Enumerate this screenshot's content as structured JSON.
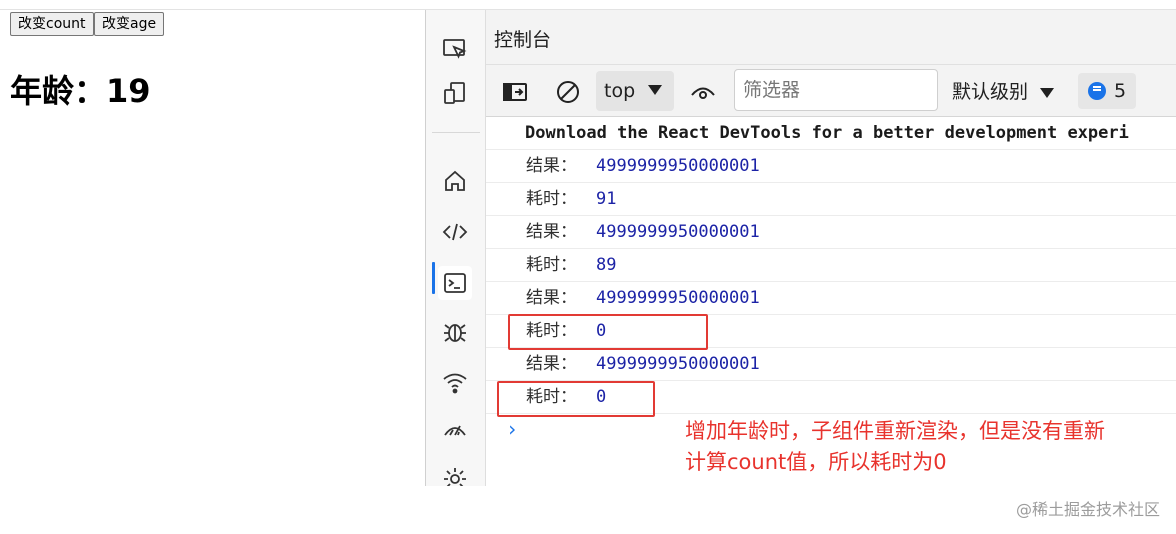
{
  "page": {
    "buttons": {
      "change_count": "改变count",
      "change_age": "改变age"
    },
    "age_label": "年龄：",
    "age_value": "19"
  },
  "devtools": {
    "title": "控制台",
    "toolbar": {
      "context": "top",
      "filter_placeholder": "筛选器",
      "levels": "默认级别",
      "issues_count": "5"
    },
    "activity_icons": [
      "inspect-icon",
      "device-emulation-icon",
      "home-icon",
      "elements-icon",
      "console-icon",
      "sources-bug-icon",
      "network-wifi-icon",
      "performance-icon",
      "settings-gear-icon"
    ],
    "console": {
      "info_message": "Download the React DevTools for a better development experi",
      "entries": [
        {
          "label": "结果：",
          "value": "4999999950000001"
        },
        {
          "label": "耗时：",
          "value": "91"
        },
        {
          "label": "结果：",
          "value": "4999999950000001"
        },
        {
          "label": "耗时：",
          "value": "89"
        },
        {
          "label": "结果：",
          "value": "4999999950000001"
        },
        {
          "label": "耗时：",
          "value": "0"
        },
        {
          "label": "结果：",
          "value": "4999999950000001"
        },
        {
          "label": "耗时：",
          "value": "0"
        }
      ],
      "prompt": "›"
    }
  },
  "annotation": {
    "line1": "增加年龄时，子组件重新渲染，但是没有重新",
    "line2": "计算count值，所以耗时为0",
    "color": "#e8332d"
  },
  "watermark": "@稀土掘金技术社区",
  "colors": {
    "value_blue": "#1c23a6",
    "accent": "#1a73e8",
    "highlight_red": "#e23a34"
  }
}
